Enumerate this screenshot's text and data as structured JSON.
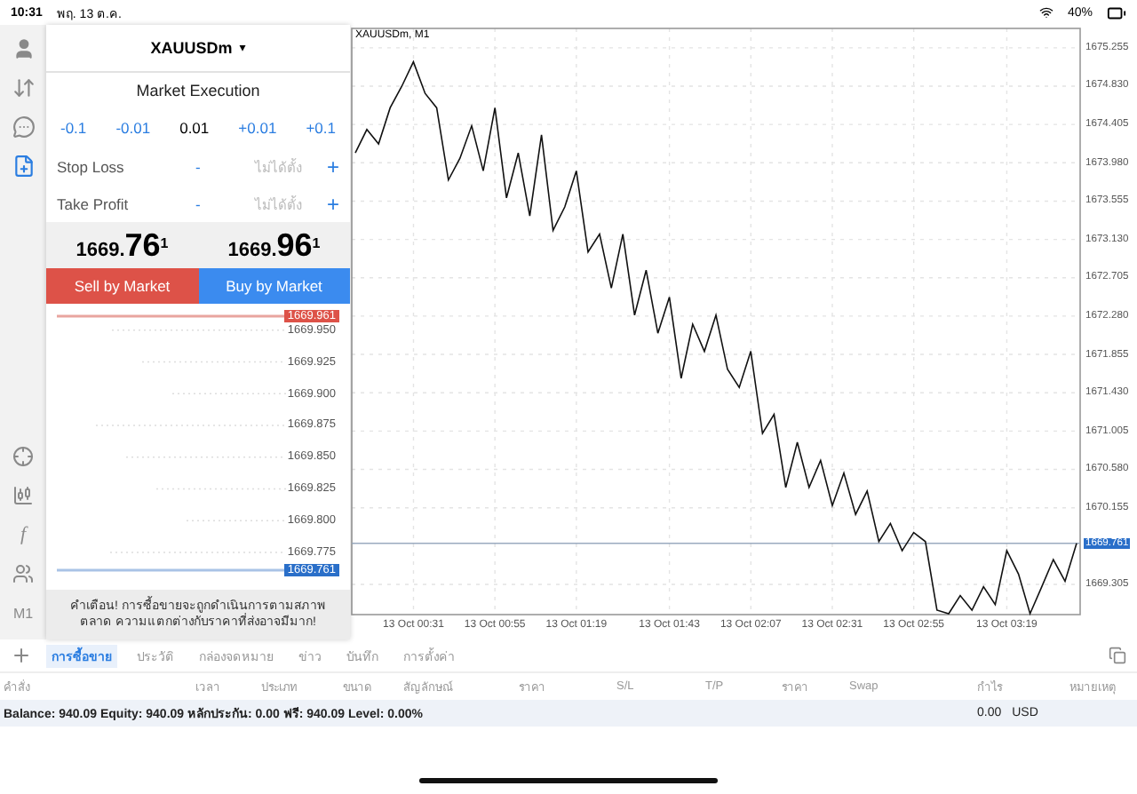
{
  "status_bar": {
    "time": "10:31",
    "date": "พฤ. 13 ต.ค.",
    "battery": "40%"
  },
  "rail_top": [
    {
      "kind": "account",
      "selected": false
    },
    {
      "kind": "trade",
      "selected": false
    },
    {
      "kind": "chat",
      "selected": false
    },
    {
      "kind": "new-order",
      "selected": true
    }
  ],
  "rail_bottom": [
    {
      "kind": "crosshair"
    },
    {
      "kind": "candles"
    },
    {
      "kind": "indicator",
      "label": "f"
    },
    {
      "kind": "objects"
    },
    {
      "kind": "period",
      "label": "M1"
    }
  ],
  "order_panel": {
    "symbol": "XAUUSDm",
    "caret": "▾",
    "mode": "Market Execution",
    "volume_down": [
      "-0.1",
      "-0.01"
    ],
    "volume": "0.01",
    "volume_up": [
      "+0.01",
      "+0.1"
    ],
    "stops": [
      {
        "label": "Stop Loss",
        "minus": "-",
        "value": "ไม่ได้ตั้ง",
        "plus": "+"
      },
      {
        "label": "Take Profit",
        "minus": "-",
        "value": "ไม่ได้ตั้ง",
        "plus": "+"
      }
    ],
    "bid": {
      "head": "1669.",
      "big": "76",
      "tail": "1"
    },
    "ask": {
      "head": "1669.",
      "big": "96",
      "tail": "1"
    },
    "sell_button": "Sell by Market",
    "buy_button": "Buy by Market",
    "tick_labels": [
      {
        "text": "1669.961",
        "kind": "ask"
      },
      {
        "text": "1669.950",
        "kind": "tick"
      },
      {
        "text": "1669.925",
        "kind": "tick"
      },
      {
        "text": "1669.900",
        "kind": "tick"
      },
      {
        "text": "1669.875",
        "kind": "tick"
      },
      {
        "text": "1669.850",
        "kind": "tick"
      },
      {
        "text": "1669.825",
        "kind": "tick"
      },
      {
        "text": "1669.800",
        "kind": "tick"
      },
      {
        "text": "1669.775",
        "kind": "tick"
      },
      {
        "text": "1669.761",
        "kind": "bid"
      }
    ],
    "warning": "คำเตือน! การซื้อขายจะถูกดำเนินการตามสภาพตลาด ความแตกต่างกับราคาที่ส่งอาจมีมาก!"
  },
  "chart": {
    "title": "XAUUSDm, M1",
    "chart_data": {
      "type": "line",
      "grid": true,
      "ylim": [
        1668.97,
        1675.47
      ],
      "categories": [
        null,
        null,
        null,
        null,
        null,
        "13 Oct 00:31",
        null,
        null,
        null,
        null,
        null,
        null,
        "13 Oct 00:55",
        null,
        null,
        null,
        null,
        null,
        null,
        "13 Oct 01:19",
        null,
        null,
        null,
        null,
        null,
        null,
        null,
        "13 Oct 01:43",
        null,
        null,
        null,
        null,
        null,
        null,
        "13 Oct 02:07",
        null,
        null,
        null,
        null,
        null,
        null,
        "13 Oct 02:31",
        null,
        null,
        null,
        null,
        null,
        null,
        "13 Oct 02:55",
        null,
        null,
        null,
        null,
        null,
        null,
        null,
        "13 Oct 03:19",
        null,
        null,
        null,
        null,
        null,
        null
      ],
      "ref_lines": [
        {
          "axis": "y",
          "value": 1669.761,
          "label": "1669.761",
          "color": "#9aaabf"
        }
      ],
      "series": [
        {
          "color": "#111111",
          "values": [
            1674.09,
            1674.35,
            1674.19,
            1674.59,
            1674.83,
            1675.1,
            1674.75,
            1674.59,
            1673.79,
            1674.03,
            1674.39,
            1673.89,
            1674.59,
            1673.59,
            1674.09,
            1673.39,
            1674.29,
            1673.23,
            1673.49,
            1673.89,
            1672.99,
            1673.19,
            1672.59,
            1673.19,
            1672.29,
            1672.79,
            1672.09,
            1672.49,
            1671.59,
            1672.19,
            1671.89,
            1672.29,
            1671.69,
            1671.49,
            1671.89,
            1670.98,
            1671.19,
            1670.38,
            1670.88,
            1670.38,
            1670.68,
            1670.18,
            1670.54,
            1670.08,
            1670.34,
            1669.78,
            1669.98,
            1669.68,
            1669.88,
            1669.78,
            1669.02,
            1668.98,
            1669.18,
            1669.02,
            1669.28,
            1669.08,
            1669.68,
            1669.42,
            1668.98,
            1669.28,
            1669.58,
            1669.34,
            1669.76
          ]
        }
      ],
      "yticks": [
        {
          "value": 1675.255,
          "label": "1675.255"
        },
        {
          "value": 1674.83,
          "label": "1674.830"
        },
        {
          "value": 1674.405,
          "label": "1674.405"
        },
        {
          "value": 1673.98,
          "label": "1673.980"
        },
        {
          "value": 1673.555,
          "label": "1673.555"
        },
        {
          "value": 1673.13,
          "label": "1673.130"
        },
        {
          "value": 1672.705,
          "label": "1672.705"
        },
        {
          "value": 1672.28,
          "label": "1672.280"
        },
        {
          "value": 1671.855,
          "label": "1671.855"
        },
        {
          "value": 1671.43,
          "label": "1671.430"
        },
        {
          "value": 1671.005,
          "label": "1671.005"
        },
        {
          "value": 1670.58,
          "label": "1670.580"
        },
        {
          "value": 1670.155,
          "label": "1670.155"
        },
        {
          "value": 1669.305,
          "label": "1669.305"
        }
      ]
    }
  },
  "bottom_tabs": [
    {
      "label": "การซื้อขาย",
      "selected": true
    },
    {
      "label": "ประวัติ",
      "selected": false
    },
    {
      "label": "กล่องจดหมาย",
      "selected": false
    },
    {
      "label": "ข่าว",
      "selected": false
    },
    {
      "label": "บันทึก",
      "selected": false
    },
    {
      "label": "การตั้งค่า",
      "selected": false
    }
  ],
  "table": {
    "columns": [
      "คำสั่ง",
      "เวลา",
      "ประเภท",
      "ขนาด",
      "สัญลักษณ์",
      "ราคา",
      "S/L",
      "T/P",
      "ราคา",
      "Swap",
      "กำไร",
      "หมายเหตุ"
    ]
  },
  "balance": {
    "summary": "Balance: 940.09 Equity: 940.09 หลักประกัน: 0.00 ฟรี: 940.09 Level: 0.00%",
    "profit": "0.00",
    "currency": "USD"
  }
}
